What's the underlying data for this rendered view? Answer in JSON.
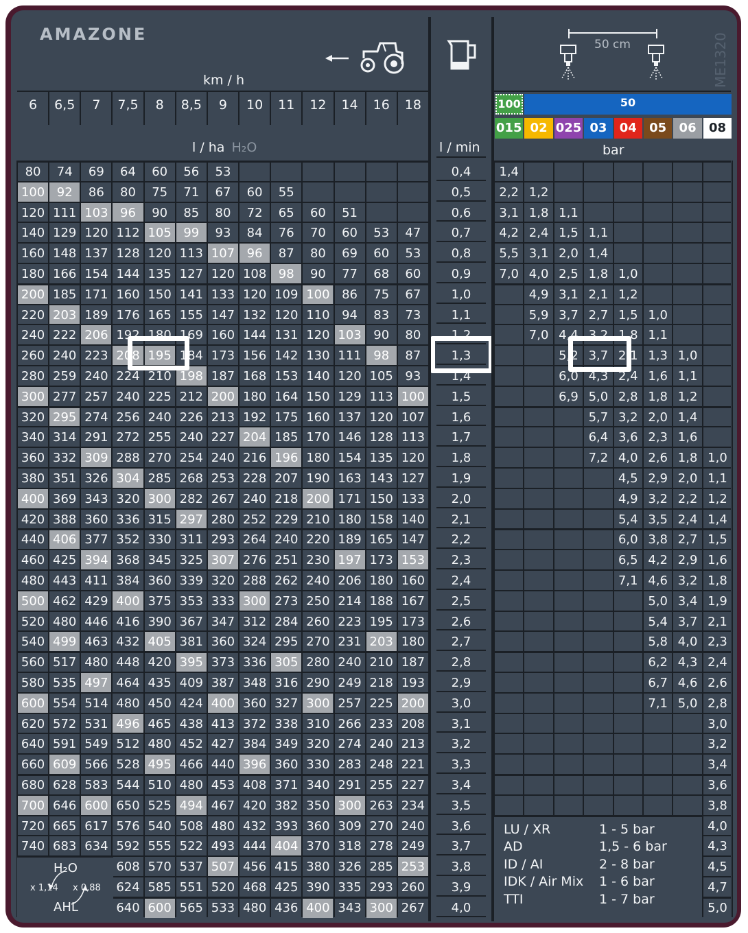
{
  "brand": "AMAZONE",
  "doc_code": "ME1320",
  "speed_unit": "km / h",
  "rate_unit": "l / ha",
  "rate_unit_sub": "H₂O",
  "flow_unit": "l / min",
  "pressure_unit": "bar",
  "nozzle_spacing": "50 cm",
  "speeds": [
    "6",
    "6,5",
    "7",
    "7,5",
    "8",
    "8,5",
    "9",
    "10",
    "11",
    "12",
    "14",
    "16",
    "18"
  ],
  "nozzle_spacing_labels": [
    "100",
    "50"
  ],
  "nozzle_sizes": [
    {
      "label": "015",
      "color": "#43a047"
    },
    {
      "label": "02",
      "color": "#f6b800"
    },
    {
      "label": "025",
      "color": "#8e44ad"
    },
    {
      "label": "03",
      "color": "#1565c0"
    },
    {
      "label": "04",
      "color": "#e1251b"
    },
    {
      "label": "05",
      "color": "#7a4a1c"
    },
    {
      "label": "06",
      "color": "#9a9ea3"
    },
    {
      "label": "08",
      "color": "#ffffff"
    }
  ],
  "flows": [
    "0,4",
    "0,5",
    "0,6",
    "0,7",
    "0,8",
    "0,9",
    "1,0",
    "1,1",
    "1,2",
    "1,3",
    "1,4",
    "1,5",
    "1,6",
    "1,7",
    "1,8",
    "1,9",
    "2,0",
    "2,1",
    "2,2",
    "2,3",
    "2,4",
    "2,5",
    "2,6",
    "2,7",
    "2,8",
    "2,9",
    "3,0",
    "3,1",
    "3,2",
    "3,3",
    "3,4",
    "3,5",
    "3,6",
    "3,7",
    "3,8",
    "3,9",
    "4,0"
  ],
  "rates": [
    [
      "80",
      "74",
      "69",
      "64",
      "60",
      "56",
      "53",
      "",
      "",
      "",
      "",
      "",
      ""
    ],
    [
      "100",
      "92",
      "86",
      "80",
      "75",
      "71",
      "67",
      "60",
      "55",
      "",
      "",
      "",
      ""
    ],
    [
      "120",
      "111",
      "103",
      "96",
      "90",
      "85",
      "80",
      "72",
      "65",
      "60",
      "51",
      "",
      ""
    ],
    [
      "140",
      "129",
      "120",
      "112",
      "105",
      "99",
      "93",
      "84",
      "76",
      "70",
      "60",
      "53",
      "47"
    ],
    [
      "160",
      "148",
      "137",
      "128",
      "120",
      "113",
      "107",
      "96",
      "87",
      "80",
      "69",
      "60",
      "53"
    ],
    [
      "180",
      "166",
      "154",
      "144",
      "135",
      "127",
      "120",
      "108",
      "98",
      "90",
      "77",
      "68",
      "60"
    ],
    [
      "200",
      "185",
      "171",
      "160",
      "150",
      "141",
      "133",
      "120",
      "109",
      "100",
      "86",
      "75",
      "67"
    ],
    [
      "220",
      "203",
      "189",
      "176",
      "165",
      "155",
      "147",
      "132",
      "120",
      "110",
      "94",
      "83",
      "73"
    ],
    [
      "240",
      "222",
      "206",
      "192",
      "180",
      "169",
      "160",
      "144",
      "131",
      "120",
      "103",
      "90",
      "80"
    ],
    [
      "260",
      "240",
      "223",
      "208",
      "195",
      "184",
      "173",
      "156",
      "142",
      "130",
      "111",
      "98",
      "87"
    ],
    [
      "280",
      "259",
      "240",
      "224",
      "210",
      "198",
      "187",
      "168",
      "153",
      "140",
      "120",
      "105",
      "93"
    ],
    [
      "300",
      "277",
      "257",
      "240",
      "225",
      "212",
      "200",
      "180",
      "164",
      "150",
      "129",
      "113",
      "100"
    ],
    [
      "320",
      "295",
      "274",
      "256",
      "240",
      "226",
      "213",
      "192",
      "175",
      "160",
      "137",
      "120",
      "107"
    ],
    [
      "340",
      "314",
      "291",
      "272",
      "255",
      "240",
      "227",
      "204",
      "185",
      "170",
      "146",
      "128",
      "113"
    ],
    [
      "360",
      "332",
      "309",
      "288",
      "270",
      "254",
      "240",
      "216",
      "196",
      "180",
      "154",
      "135",
      "120"
    ],
    [
      "380",
      "351",
      "326",
      "304",
      "285",
      "268",
      "253",
      "228",
      "207",
      "190",
      "163",
      "143",
      "127"
    ],
    [
      "400",
      "369",
      "343",
      "320",
      "300",
      "282",
      "267",
      "240",
      "218",
      "200",
      "171",
      "150",
      "133"
    ],
    [
      "420",
      "388",
      "360",
      "336",
      "315",
      "297",
      "280",
      "252",
      "229",
      "210",
      "180",
      "158",
      "140"
    ],
    [
      "440",
      "406",
      "377",
      "352",
      "330",
      "311",
      "293",
      "264",
      "240",
      "220",
      "189",
      "165",
      "147"
    ],
    [
      "460",
      "425",
      "394",
      "368",
      "345",
      "325",
      "307",
      "276",
      "251",
      "230",
      "197",
      "173",
      "153"
    ],
    [
      "480",
      "443",
      "411",
      "384",
      "360",
      "339",
      "320",
      "288",
      "262",
      "240",
      "206",
      "180",
      "160"
    ],
    [
      "500",
      "462",
      "429",
      "400",
      "375",
      "353",
      "333",
      "300",
      "273",
      "250",
      "214",
      "188",
      "167"
    ],
    [
      "520",
      "480",
      "446",
      "416",
      "390",
      "367",
      "347",
      "312",
      "284",
      "260",
      "223",
      "195",
      "173"
    ],
    [
      "540",
      "499",
      "463",
      "432",
      "405",
      "381",
      "360",
      "324",
      "295",
      "270",
      "231",
      "203",
      "180"
    ],
    [
      "560",
      "517",
      "480",
      "448",
      "420",
      "395",
      "373",
      "336",
      "305",
      "280",
      "240",
      "210",
      "187"
    ],
    [
      "580",
      "535",
      "497",
      "464",
      "435",
      "409",
      "387",
      "348",
      "316",
      "290",
      "249",
      "218",
      "193"
    ],
    [
      "600",
      "554",
      "514",
      "480",
      "450",
      "424",
      "400",
      "360",
      "327",
      "300",
      "257",
      "225",
      "200"
    ],
    [
      "620",
      "572",
      "531",
      "496",
      "465",
      "438",
      "413",
      "372",
      "338",
      "310",
      "266",
      "233",
      "208"
    ],
    [
      "640",
      "591",
      "549",
      "512",
      "480",
      "452",
      "427",
      "384",
      "349",
      "320",
      "274",
      "240",
      "213"
    ],
    [
      "660",
      "609",
      "566",
      "528",
      "495",
      "466",
      "440",
      "396",
      "360",
      "330",
      "283",
      "248",
      "221"
    ],
    [
      "680",
      "628",
      "583",
      "544",
      "510",
      "480",
      "453",
      "408",
      "371",
      "340",
      "291",
      "255",
      "227"
    ],
    [
      "700",
      "646",
      "600",
      "650",
      "525",
      "494",
      "467",
      "420",
      "382",
      "350",
      "300",
      "263",
      "234"
    ],
    [
      "720",
      "665",
      "617",
      "576",
      "540",
      "508",
      "480",
      "432",
      "393",
      "360",
      "309",
      "270",
      "240"
    ],
    [
      "740",
      "683",
      "634",
      "592",
      "555",
      "522",
      "493",
      "444",
      "404",
      "370",
      "318",
      "278",
      "249"
    ],
    [
      "",
      "",
      "",
      "608",
      "570",
      "537",
      "507",
      "456",
      "415",
      "380",
      "326",
      "285",
      "253"
    ],
    [
      "",
      "",
      "",
      "624",
      "585",
      "551",
      "520",
      "468",
      "425",
      "390",
      "335",
      "293",
      "260"
    ],
    [
      "",
      "",
      "",
      "640",
      "600",
      "565",
      "533",
      "480",
      "436",
      "400",
      "343",
      "300",
      "267"
    ]
  ],
  "highlights": [
    [],
    [
      0,
      1
    ],
    [
      2,
      3
    ],
    [
      4,
      5
    ],
    [
      6,
      7
    ],
    [
      8
    ],
    [
      0,
      9
    ],
    [
      1
    ],
    [
      2,
      10
    ],
    [
      3,
      4,
      11
    ],
    [
      5
    ],
    [
      0,
      6,
      12
    ],
    [
      1
    ],
    [
      7
    ],
    [
      2,
      8
    ],
    [
      3
    ],
    [
      0,
      4,
      9
    ],
    [
      5
    ],
    [
      1
    ],
    [
      2,
      6,
      10,
      12
    ],
    [],
    [
      0,
      3,
      7
    ],
    [],
    [
      1,
      4,
      11
    ],
    [
      5,
      8
    ],
    [
      2
    ],
    [
      0,
      6,
      9,
      12
    ],
    [
      3
    ],
    [],
    [
      1,
      4,
      7
    ],
    [],
    [
      0,
      2,
      5,
      10
    ],
    [],
    [
      8
    ],
    [
      6,
      12
    ],
    [],
    [
      4,
      9,
      11
    ]
  ],
  "pressures": [
    [
      "1,4",
      "",
      "",
      "",
      "",
      "",
      "",
      ""
    ],
    [
      "2,2",
      "1,2",
      "",
      "",
      "",
      "",
      "",
      ""
    ],
    [
      "3,1",
      "1,8",
      "1,1",
      "",
      "",
      "",
      "",
      ""
    ],
    [
      "4,2",
      "2,4",
      "1,5",
      "1,1",
      "",
      "",
      "",
      ""
    ],
    [
      "5,5",
      "3,1",
      "2,0",
      "1,4",
      "",
      "",
      "",
      ""
    ],
    [
      "7,0",
      "4,0",
      "2,5",
      "1,8",
      "1,0",
      "",
      "",
      ""
    ],
    [
      "",
      "4,9",
      "3,1",
      "2,1",
      "1,2",
      "",
      "",
      ""
    ],
    [
      "",
      "5,9",
      "3,7",
      "2,7",
      "1,5",
      "1,0",
      "",
      ""
    ],
    [
      "",
      "7,0",
      "4,4",
      "3,2",
      "1,8",
      "1,1",
      "",
      ""
    ],
    [
      "",
      "",
      "5,2",
      "3,7",
      "2,1",
      "1,3",
      "1,0",
      ""
    ],
    [
      "",
      "",
      "6,0",
      "4,3",
      "2,4",
      "1,6",
      "1,1",
      ""
    ],
    [
      "",
      "",
      "6,9",
      "5,0",
      "2,8",
      "1,8",
      "1,2",
      ""
    ],
    [
      "",
      "",
      "",
      "5,7",
      "3,2",
      "2,0",
      "1,4",
      ""
    ],
    [
      "",
      "",
      "",
      "6,4",
      "3,6",
      "2,3",
      "1,6",
      ""
    ],
    [
      "",
      "",
      "",
      "7,2",
      "4,0",
      "2,6",
      "1,8",
      "1,0"
    ],
    [
      "",
      "",
      "",
      "",
      "4,5",
      "2,9",
      "2,0",
      "1,1"
    ],
    [
      "",
      "",
      "",
      "",
      "4,9",
      "3,2",
      "2,2",
      "1,2"
    ],
    [
      "",
      "",
      "",
      "",
      "5,4",
      "3,5",
      "2,4",
      "1,4"
    ],
    [
      "",
      "",
      "",
      "",
      "6,0",
      "3,8",
      "2,7",
      "1,5"
    ],
    [
      "",
      "",
      "",
      "",
      "6,5",
      "4,2",
      "2,9",
      "1,6"
    ],
    [
      "",
      "",
      "",
      "",
      "7,1",
      "4,6",
      "3,2",
      "1,8"
    ],
    [
      "",
      "",
      "",
      "",
      "",
      "5,0",
      "3,4",
      "1,9"
    ],
    [
      "",
      "",
      "",
      "",
      "",
      "5,4",
      "3,7",
      "2,1"
    ],
    [
      "",
      "",
      "",
      "",
      "",
      "5,8",
      "4,0",
      "2,3"
    ],
    [
      "",
      "",
      "",
      "",
      "",
      "6,2",
      "4,3",
      "2,4"
    ],
    [
      "",
      "",
      "",
      "",
      "",
      "6,7",
      "4,6",
      "2,6"
    ],
    [
      "",
      "",
      "",
      "",
      "",
      "7,1",
      "5,0",
      "2,8"
    ],
    [
      "",
      "",
      "",
      "",
      "",
      "",
      "",
      "3,0"
    ],
    [
      "",
      "",
      "",
      "",
      "",
      "",
      "",
      "3,2"
    ],
    [
      "",
      "",
      "",
      "",
      "",
      "",
      "",
      "3,4"
    ],
    [
      "",
      "",
      "",
      "",
      "",
      "",
      "",
      "3,6"
    ],
    [
      "",
      "",
      "",
      "",
      "",
      "",
      "",
      "3,8"
    ],
    [
      "",
      "",
      "",
      "",
      "",
      "",
      "",
      "4,0"
    ],
    [
      "",
      "",
      "",
      "",
      "",
      "",
      "",
      "4,3"
    ],
    [
      "",
      "",
      "",
      "",
      "",
      "",
      "",
      "4,5"
    ],
    [
      "",
      "",
      "",
      "",
      "",
      "",
      "",
      "4,7"
    ],
    [
      "",
      "",
      "",
      "",
      "",
      "",
      "",
      "5,0"
    ]
  ],
  "nozzle_types": [
    {
      "name": "LU / XR",
      "range": "1 - 5 bar"
    },
    {
      "name": "AD",
      "range": "1,5 - 6 bar"
    },
    {
      "name": "ID / AI",
      "range": "2 - 8 bar"
    },
    {
      "name": "IDK / Air Mix",
      "range": "1 - 6 bar"
    },
    {
      "name": "TTI",
      "range": "1 - 7 bar"
    }
  ],
  "conversion": {
    "medium": "H₂O",
    "fertilizer": "AHL",
    "factor_to_water": "x 1,14",
    "factor_to_ahl": "x 0,88"
  },
  "example": {
    "speed": "8",
    "rate": "195",
    "flow": "1,3",
    "nozzle": "03",
    "pressure": "3,7"
  }
}
